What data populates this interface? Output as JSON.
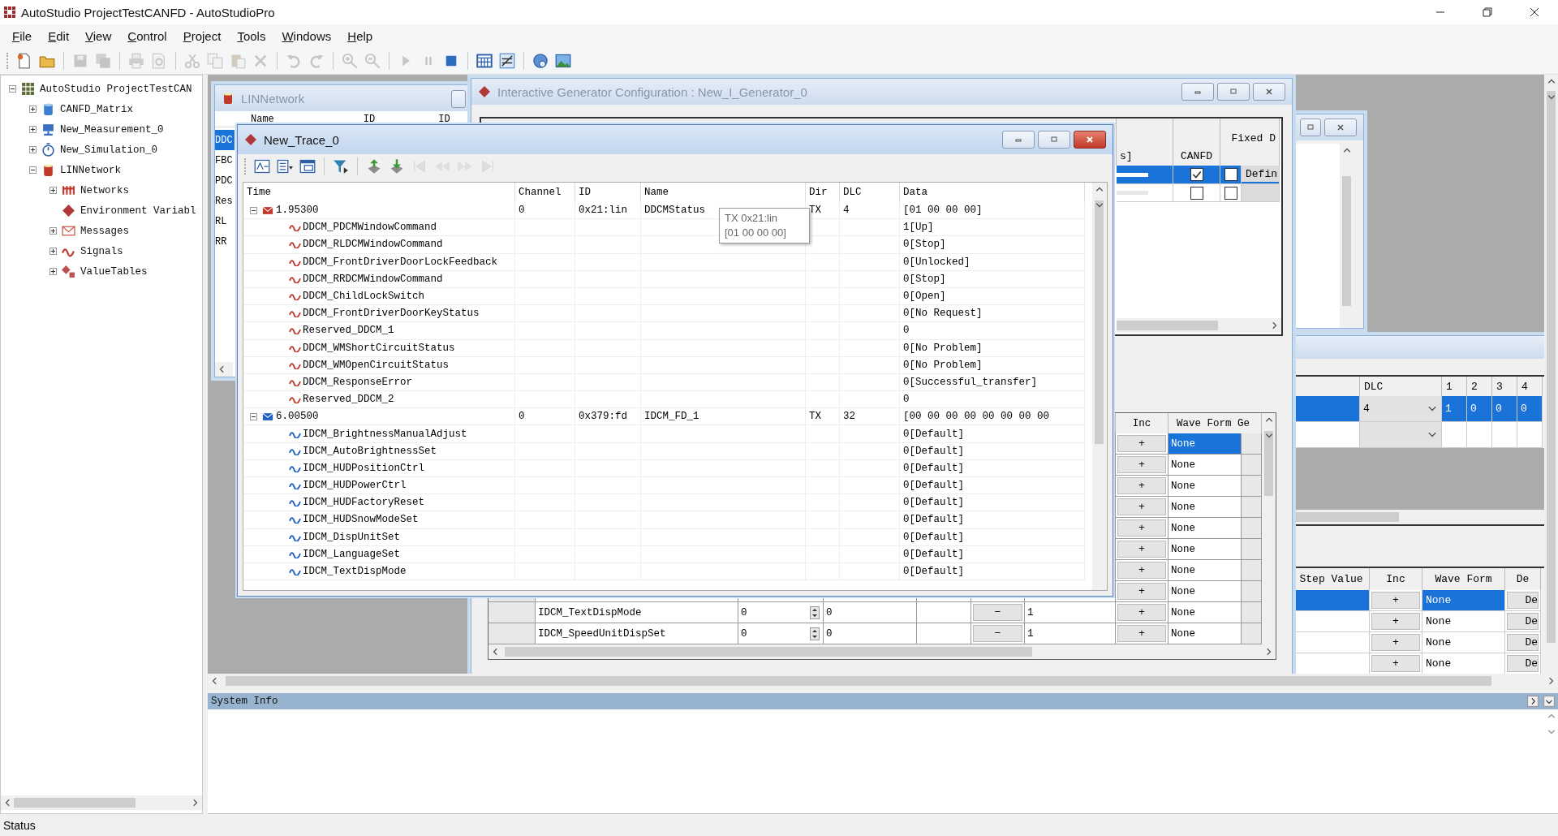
{
  "app": {
    "title": "AutoStudio ProjectTestCANFD - AutoStudioPro"
  },
  "menu": [
    {
      "label": "File"
    },
    {
      "label": "Edit"
    },
    {
      "label": "View"
    },
    {
      "label": "Control"
    },
    {
      "label": "Project"
    },
    {
      "label": "Tools"
    },
    {
      "label": "Windows"
    },
    {
      "label": "Help"
    }
  ],
  "toolbar": [
    [
      {
        "kind": "new-file",
        "disabled": false
      },
      {
        "kind": "folder",
        "disabled": false
      }
    ],
    [
      {
        "kind": "floppy",
        "disabled": true
      },
      {
        "kind": "floppies",
        "disabled": true
      }
    ],
    [
      {
        "kind": "printer",
        "disabled": true
      },
      {
        "kind": "print-preview",
        "disabled": true
      }
    ],
    [
      {
        "kind": "scissors",
        "disabled": true
      },
      {
        "kind": "copy",
        "disabled": true
      },
      {
        "kind": "paste",
        "disabled": true
      },
      {
        "kind": "delete",
        "disabled": true
      }
    ],
    [
      {
        "kind": "undo",
        "disabled": true
      },
      {
        "kind": "redo",
        "disabled": true
      }
    ],
    [
      {
        "kind": "zoom-in",
        "disabled": true
      },
      {
        "kind": "zoom-out",
        "disabled": true
      }
    ],
    [
      {
        "kind": "play",
        "disabled": true
      },
      {
        "kind": "pause",
        "disabled": true
      },
      {
        "kind": "stop",
        "disabled": false
      }
    ],
    [
      {
        "kind": "grid",
        "disabled": false
      },
      {
        "kind": "format-toggle",
        "disabled": false
      }
    ],
    [
      {
        "kind": "help",
        "disabled": false
      },
      {
        "kind": "image",
        "disabled": false
      }
    ]
  ],
  "tree": {
    "label": "AutoStudio ProjectTestCAN",
    "kind": "project",
    "expanded": true,
    "children": [
      {
        "label": "CANFD_Matrix",
        "kind": "matrix-db",
        "expanded": false
      },
      {
        "label": "New_Measurement_0",
        "kind": "monitor",
        "expanded": false
      },
      {
        "label": "New_Simulation_0",
        "kind": "stopwatch",
        "expanded": false
      },
      {
        "label": "LINNetwork",
        "kind": "network-db",
        "expanded": true,
        "children": [
          {
            "label": "Networks",
            "kind": "network",
            "expanded": false
          },
          {
            "label": "Environment Variabl",
            "kind": "diamond"
          },
          {
            "label": "Messages",
            "kind": "envelope",
            "expanded": false
          },
          {
            "label": "Signals",
            "kind": "wave",
            "expanded": false
          },
          {
            "label": "ValueTables",
            "kind": "value-table",
            "expanded": false
          }
        ]
      }
    ]
  },
  "lin_network": {
    "title": "LINNetwork",
    "columns": [
      "Name",
      "ID",
      "ID"
    ],
    "rows": [
      {
        "name": "DDC",
        "selected": true
      },
      {
        "name": "FBC",
        "selected": false
      },
      {
        "name": "PDC",
        "selected": false
      },
      {
        "name": "Res",
        "selected": false
      },
      {
        "name": "RL",
        "selected": false
      },
      {
        "name": "RR",
        "selected": false
      }
    ]
  },
  "generator": {
    "title": "Interactive Generator Configuration : New_I_Generator_0",
    "frames": {
      "columns": [
        "s]",
        "CANFD",
        "Fixed D"
      ],
      "rows": [
        {
          "selected": true,
          "canfd": true,
          "fixed": false,
          "button": "Defin"
        },
        {
          "selected": false,
          "canfd": false,
          "fixed": false
        }
      ]
    },
    "signals": {
      "columns": [
        "Inc",
        "Wave Form Ge"
      ],
      "rows": [
        {
          "selected": true,
          "inc": "+",
          "wave_form": "None"
        },
        {
          "selected": false,
          "inc": "+",
          "wave_form": "None"
        },
        {
          "selected": false,
          "inc": "+",
          "wave_form": "None"
        },
        {
          "selected": false,
          "inc": "+",
          "wave_form": "None"
        },
        {
          "selected": false,
          "inc": "+",
          "wave_form": "None"
        },
        {
          "selected": false,
          "inc": "+",
          "wave_form": "None"
        },
        {
          "selected": false,
          "inc": "+",
          "wave_form": "None"
        },
        {
          "selected": false,
          "inc": "+",
          "wave_form": "None"
        },
        {
          "selected": false,
          "name": "IDCM_TextDispMode",
          "value": "0",
          "raw": "0",
          "dec": "−",
          "step": "1",
          "inc": "+",
          "wave_form": "None"
        },
        {
          "selected": false,
          "name": "IDCM_SpeedUnitDispSet",
          "value": "0",
          "raw": "0",
          "dec": "−",
          "step": "1",
          "inc": "+",
          "wave_form": "None"
        }
      ]
    }
  },
  "generator_2": {
    "dlc_table": {
      "columns": [
        "DLC",
        "1",
        "2",
        "3",
        "4"
      ],
      "rows": [
        {
          "selected": true,
          "dlc": "4",
          "bytes": [
            "1",
            "0",
            "0",
            "0"
          ]
        },
        {
          "selected": false
        }
      ]
    },
    "signals": {
      "columns": [
        "Step Value",
        "Inc",
        "Wave Form",
        "De"
      ],
      "rows": [
        {
          "selected": true,
          "inc": "+",
          "wave_form": "None",
          "default": "De"
        },
        {
          "selected": false,
          "inc": "+",
          "wave_form": "None",
          "default": "De"
        },
        {
          "selected": false,
          "inc": "+",
          "wave_form": "None",
          "default": "De"
        },
        {
          "selected": false,
          "inc": "+",
          "wave_form": "None",
          "default": "De"
        }
      ]
    }
  },
  "trace": {
    "title": "New_Trace_0",
    "toolbar": [
      {
        "kind": "time-axis",
        "disabled": false
      },
      {
        "kind": "columns",
        "disabled": false
      },
      {
        "kind": "window",
        "disabled": false
      },
      {
        "kind": "filter",
        "disabled": false
      },
      {
        "kind": "export",
        "disabled": false
      },
      {
        "kind": "import",
        "disabled": false
      },
      {
        "kind": "skip-start",
        "disabled": true
      },
      {
        "kind": "rewind",
        "disabled": true
      },
      {
        "kind": "fast-forward",
        "disabled": true
      },
      {
        "kind": "skip-end",
        "disabled": true
      }
    ],
    "columns": [
      "Time",
      "Channel",
      "ID",
      "Name",
      "Dir",
      "DLC",
      "Data"
    ],
    "messages": [
      {
        "time": "1.95300",
        "channel": "0",
        "id": "0x21:lin",
        "name": "DDCMStatus",
        "dir": "TX",
        "dlc": "4",
        "data": "[01 00 00 00]",
        "color": "#c0392b",
        "expanded": true,
        "signals": [
          {
            "name": "DDCM_PDCMWindowCommand",
            "value": "1[Up]"
          },
          {
            "name": "DDCM_RLDCMWindowCommand",
            "value": "0[Stop]"
          },
          {
            "name": "DDCM_FrontDriverDoorLockFeedback",
            "value": "0[Unlocked]"
          },
          {
            "name": "DDCM_RRDCMWindowCommand",
            "value": "0[Stop]"
          },
          {
            "name": "DDCM_ChildLockSwitch",
            "value": "0[Open]"
          },
          {
            "name": "DDCM_FrontDriverDoorKeyStatus",
            "value": "0[No Request]"
          },
          {
            "name": "Reserved_DDCM_1",
            "value": "0"
          },
          {
            "name": "DDCM_WMShortCircuitStatus",
            "value": "0[No Problem]"
          },
          {
            "name": "DDCM_WMOpenCircuitStatus",
            "value": "0[No Problem]"
          },
          {
            "name": "DDCM_ResponseError",
            "value": "0[Successful_transfer]"
          },
          {
            "name": "Reserved_DDCM_2",
            "value": "0"
          }
        ]
      },
      {
        "time": "6.00500",
        "channel": "0",
        "id": "0x379:fd",
        "name": "IDCM_FD_1",
        "dir": "TX",
        "dlc": "32",
        "data": "[00 00 00 00 00 00 00 00",
        "color": "#1f5fbf",
        "expanded": true,
        "signals": [
          {
            "name": "IDCM_BrightnessManualAdjust",
            "value": "0[Default]"
          },
          {
            "name": "IDCM_AutoBrightnessSet",
            "value": "0[Default]"
          },
          {
            "name": "IDCM_HUDPositionCtrl",
            "value": "0[Default]"
          },
          {
            "name": "IDCM_HUDPowerCtrl",
            "value": "0[Default]"
          },
          {
            "name": "IDCM_HUDFactoryReset",
            "value": "0[Default]"
          },
          {
            "name": "IDCM_HUDSnowModeSet",
            "value": "0[Default]"
          },
          {
            "name": "IDCM_DispUnitSet",
            "value": "0[Default]"
          },
          {
            "name": "IDCM_LanguageSet",
            "value": "0[Default]"
          },
          {
            "name": "IDCM_TextDispMode",
            "value": "0[Default]"
          }
        ]
      }
    ],
    "tooltip": [
      "TX 0x21:lin",
      "[01 00 00 00]"
    ]
  },
  "system_info": {
    "title": "System Info"
  },
  "status_bar": "Status"
}
